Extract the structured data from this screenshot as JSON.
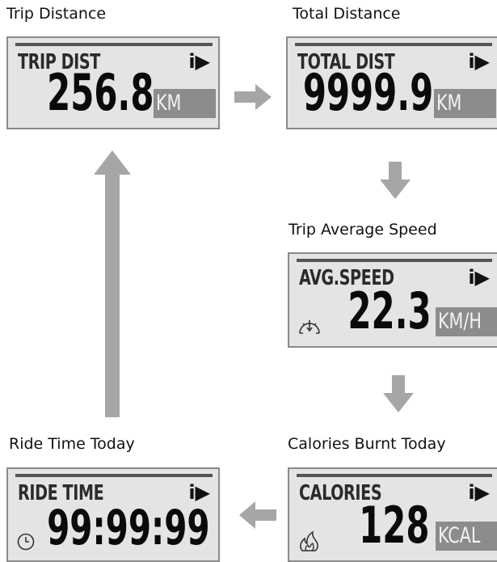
{
  "captions": {
    "trip_distance": "Trip Distance",
    "total_distance": "Total Distance",
    "avg_speed": "Trip Average Speed",
    "calories": "Calories Burnt Today",
    "ride_time": "Ride Time Today"
  },
  "screens": {
    "trip": {
      "label": "TRIP DIST",
      "info": "i▶",
      "value": "256.8",
      "unit": "KM"
    },
    "total": {
      "label": "TOTAL DIST",
      "info": "i▶",
      "value": "9999.9",
      "unit": "KM"
    },
    "speed": {
      "label": "AVG.SPEED",
      "info": "i▶",
      "value": "22.3",
      "unit": "KM/H"
    },
    "calories": {
      "label": "CALORIES",
      "info": "i▶",
      "value": "128",
      "unit": "KCAL"
    },
    "ride": {
      "label": "RIDE TIME",
      "info": "i▶",
      "value": "99:99:99"
    }
  },
  "icons": [
    "speedometer-icon",
    "flame-icon",
    "clock-icon",
    "right-arrow",
    "down-arrow",
    "left-arrow",
    "up-arrow"
  ],
  "colors": {
    "screen_bg": "#e4e4e4",
    "unit_bg": "#8c8c8c",
    "arrow": "#a6a6a6",
    "border": "#8a8a8a"
  }
}
